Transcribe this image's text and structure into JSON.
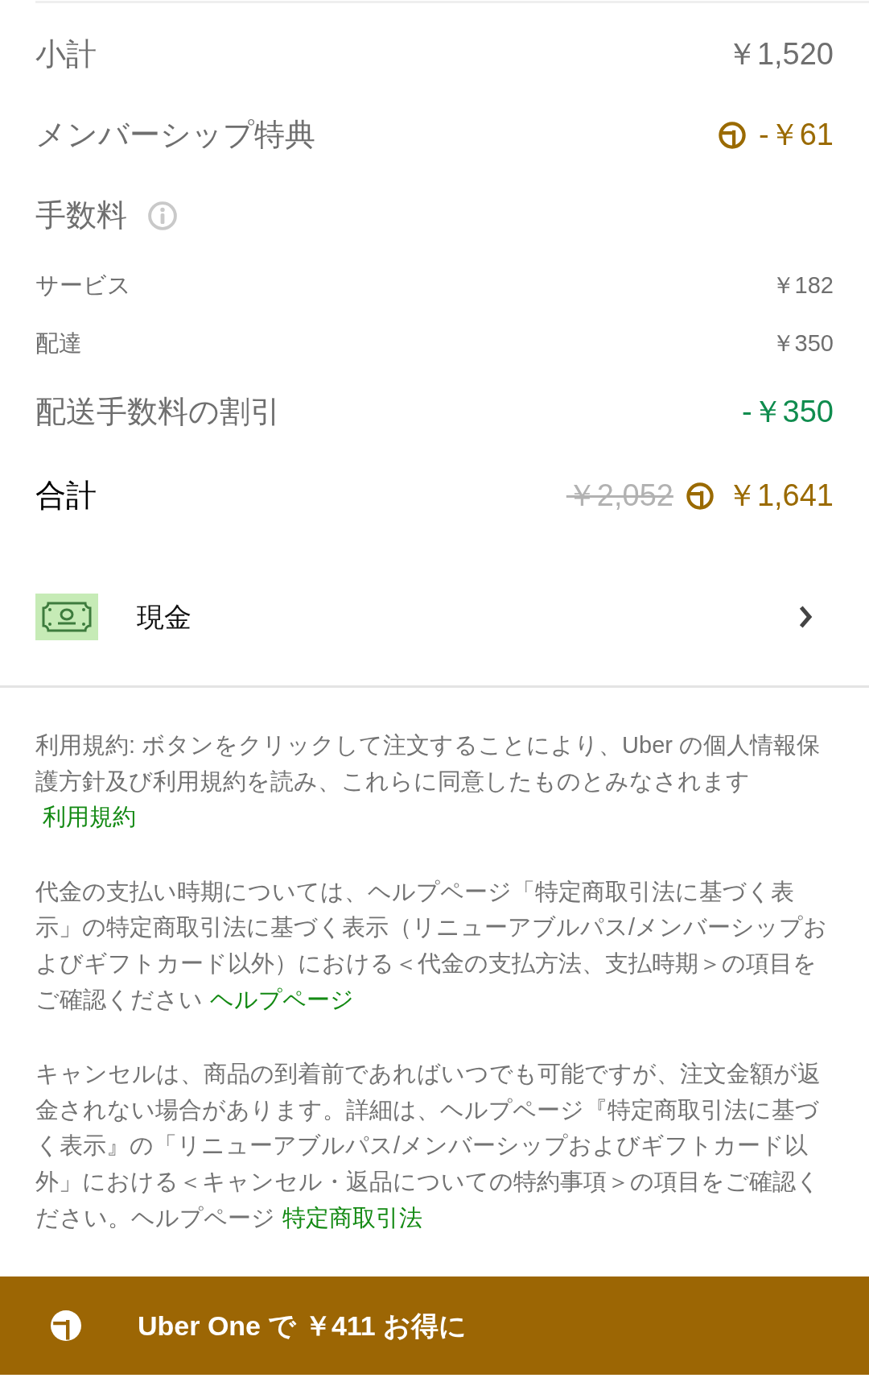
{
  "summary": {
    "lines": [
      {
        "kind": "item",
        "label": "小計",
        "amount": "￥1,520",
        "color": "#6f6f6f"
      },
      {
        "kind": "item",
        "label": "メンバーシップ特典",
        "amount": "-￥61",
        "color": "#9a6a00",
        "member_benefit": true
      },
      {
        "kind": "heading",
        "label": "手数料"
      },
      {
        "kind": "subitem",
        "label": "サービス",
        "amount": "￥182",
        "color": "#6f6f6f"
      },
      {
        "kind": "subitem",
        "label": "配達",
        "amount": "￥350",
        "color": "#6f6f6f"
      },
      {
        "kind": "item",
        "label": "配送手数料の割引",
        "amount": "-￥350",
        "color": "#0f8c4e"
      },
      {
        "kind": "total",
        "label": "合計",
        "original_amount": "￥2,052",
        "amount": "￥1,641",
        "color": "#9a6a00",
        "member_benefit": true
      }
    ]
  },
  "payment": {
    "method": "現金"
  },
  "notices": [
    {
      "text": "利用規約: ボタンをクリックして注文することにより、Uber の個人情報保護方針及び利用規約を読み、これらに同意したものとみなされます",
      "link": "利用規約"
    },
    {
      "text": "代金の支払い時期については、ヘルプページ「特定商取引法に基づく表示」の特定商取引法に基づく表示（リニューアブルパス/メンバーシップおよびギフトカード以外）における＜代金の支払方法、支払時期＞の項目をご確認ください",
      "link": "ヘルプページ"
    },
    {
      "text": "キャンセルは、商品の到着前であればいつでも可能ですが、注文金額が返金されない場合があります。詳細は、ヘルプページ『特定商取引法に基づく表示』の「リニューアブルパス/メンバーシップおよびギフトカード以外」における＜キャンセル・返品についての特約事項＞の項目をご確認ください。ヘルプページ",
      "link": "特定商取引法"
    }
  ],
  "banner": {
    "text": "Uber One で ￥411 お得に"
  }
}
